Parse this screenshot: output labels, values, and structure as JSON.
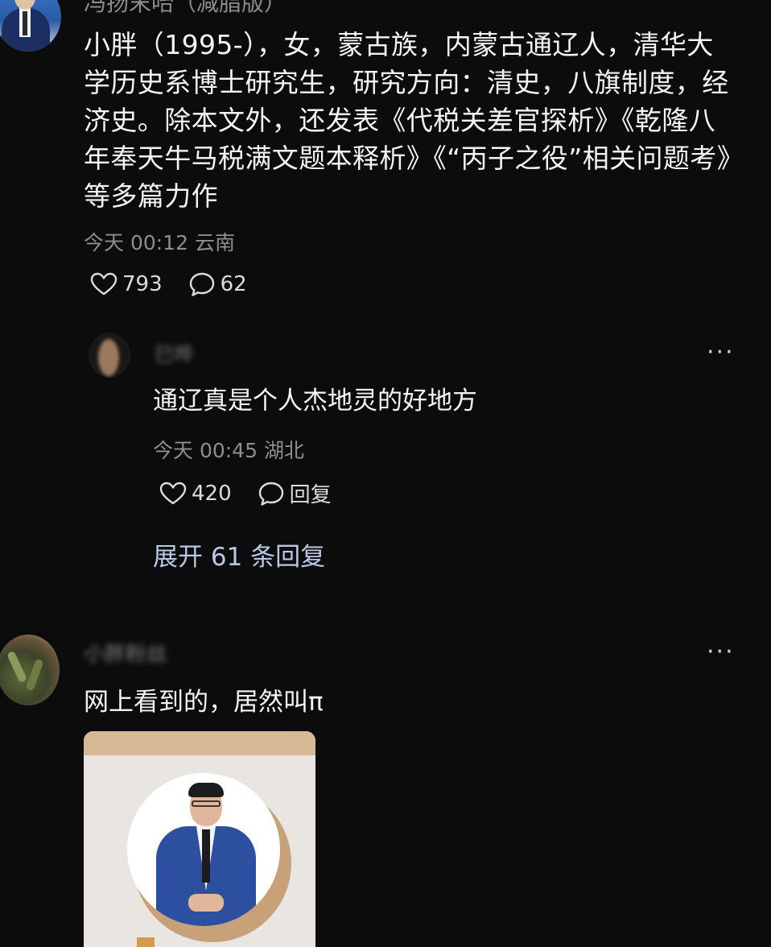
{
  "top_comment": {
    "username": "冯扬末咍（减脂版）",
    "text": "小胖（1995-），女，蒙古族，内蒙古通辽人，清华大学历史系博士研究生，研究方向：清史，八旗制度，经济史。除本文外，还发表《代税关差官探析》《乾隆八年奉天牛马税满文题本释析》《“丙子之役”相关问题考》等多篇力作",
    "meta": "今天 00:12 云南",
    "likes": "793",
    "comments": "62"
  },
  "reply": {
    "username": "巳哗",
    "text": "通辽真是个人杰地灵的好地方",
    "meta": "今天 00:45 湖北",
    "likes": "420",
    "reply_label": "回复",
    "more_label": "···",
    "expand_label": "展开 61 条回复"
  },
  "second_comment": {
    "username": "小胖粉丝",
    "text": "网上看到的，居然叫π",
    "more_label": "···"
  },
  "icons": {
    "like": "heart-icon",
    "comment": "comment-bubble-icon",
    "more": "more-dots-icon"
  },
  "colors": {
    "background": "#0c0c0d",
    "text": "#f4f4f4",
    "meta": "#8e8e92",
    "link": "#b9c8e6"
  }
}
